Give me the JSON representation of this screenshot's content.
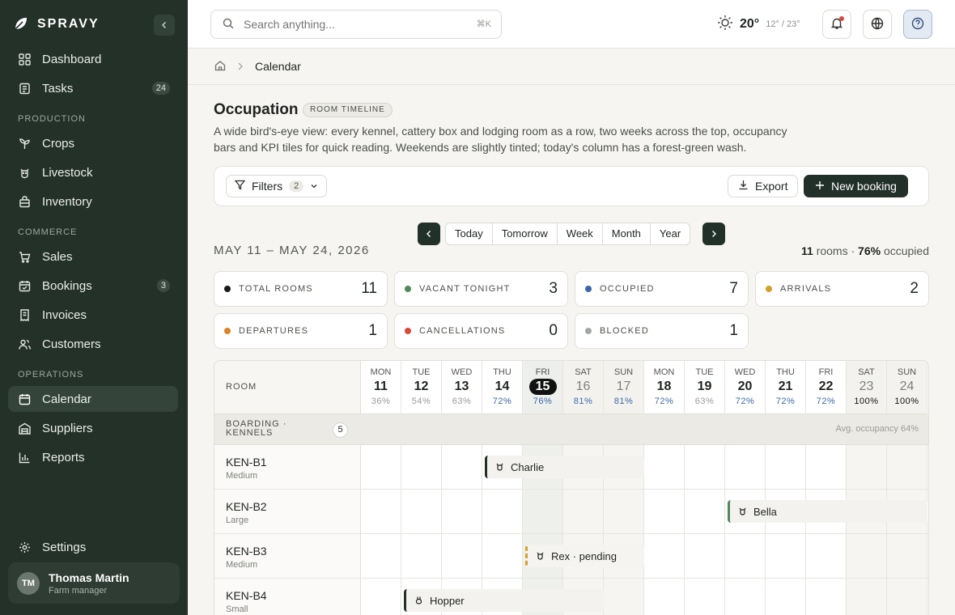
{
  "brand": {
    "name": "SPRAVY"
  },
  "sidebar": {
    "items": [
      {
        "label": "Dashboard",
        "icon": "grid-icon"
      },
      {
        "label": "Tasks",
        "icon": "clipboard-icon",
        "badge": "24"
      },
      {
        "label": "Crops",
        "icon": "sprout-icon"
      },
      {
        "label": "Livestock",
        "icon": "livestock-icon"
      },
      {
        "label": "Inventory",
        "icon": "package-icon"
      },
      {
        "label": "Sales",
        "icon": "cart-icon"
      },
      {
        "label": "Bookings",
        "icon": "calendar-check-icon",
        "badge": "3"
      },
      {
        "label": "Invoices",
        "icon": "receipt-icon"
      },
      {
        "label": "Customers",
        "icon": "users-icon"
      },
      {
        "label": "Calendar",
        "icon": "calendar-icon",
        "active": true
      },
      {
        "label": "Suppliers",
        "icon": "warehouse-icon"
      },
      {
        "label": "Reports",
        "icon": "bar-chart-icon"
      }
    ],
    "sections": {
      "production": "PRODUCTION",
      "commerce": "COMMERCE",
      "operations": "OPERATIONS"
    },
    "settings_label": "Settings",
    "user": {
      "initials": "TM",
      "name": "Thomas Martin",
      "role": "Farm manager"
    }
  },
  "topbar": {
    "search_placeholder": "Search anything...",
    "shortcut": "⌘K",
    "weather": {
      "temp": "20°",
      "range": "12° / 23°"
    }
  },
  "breadcrumb": {
    "current": "Calendar"
  },
  "page": {
    "title": "Occupation",
    "tag": "ROOM TIMELINE",
    "description": "A wide bird's-eye view: every kennel, cattery box and lodging room as a row, two weeks across the top, occupancy bars and KPI tiles for quick reading. Weekends are slightly tinted; today's column has a forest-green wash."
  },
  "toolbar": {
    "filters_label": "Filters",
    "filters_count": "2",
    "export_label": "Export",
    "new_label": "New booking"
  },
  "range_tabs": [
    "Today",
    "Tomorrow",
    "Week",
    "Month",
    "Year"
  ],
  "date_range": "MAY 11 – MAY 24, 2026",
  "summary": {
    "rooms": "11",
    "rooms_label": "rooms ·",
    "occupied": "76%",
    "occupied_label": "occupied"
  },
  "kpis": [
    {
      "label": "TOTAL ROOMS",
      "value": "11",
      "color": "#1a1a1a"
    },
    {
      "label": "VACANT TONIGHT",
      "value": "3",
      "color": "#4f8a5b"
    },
    {
      "label": "OCCUPIED",
      "value": "7",
      "color": "#3b67a8"
    },
    {
      "label": "ARRIVALS",
      "value": "2",
      "color": "#d4a02a"
    },
    {
      "label": "DEPARTURES",
      "value": "1",
      "color": "#d9822b"
    },
    {
      "label": "CANCELLATIONS",
      "value": "0",
      "color": "#d9493a"
    },
    {
      "label": "BLOCKED",
      "value": "1",
      "color": "#a3a6a1"
    }
  ],
  "grid": {
    "room_header": "ROOM",
    "days": [
      {
        "name": "MON",
        "num": "11",
        "occ": "36%"
      },
      {
        "name": "TUE",
        "num": "12",
        "occ": "54%"
      },
      {
        "name": "WED",
        "num": "13",
        "occ": "63%"
      },
      {
        "name": "THU",
        "num": "14",
        "occ": "72%"
      },
      {
        "name": "FRI",
        "num": "15",
        "occ": "76%",
        "today": true
      },
      {
        "name": "SAT",
        "num": "16",
        "occ": "81%",
        "weekend": true
      },
      {
        "name": "SUN",
        "num": "17",
        "occ": "81%",
        "weekend": true
      },
      {
        "name": "MON",
        "num": "18",
        "occ": "72%"
      },
      {
        "name": "TUE",
        "num": "19",
        "occ": "63%"
      },
      {
        "name": "WED",
        "num": "20",
        "occ": "72%"
      },
      {
        "name": "THU",
        "num": "21",
        "occ": "72%"
      },
      {
        "name": "FRI",
        "num": "22",
        "occ": "72%"
      },
      {
        "name": "SAT",
        "num": "23",
        "occ": "100%",
        "weekend": true
      },
      {
        "name": "SUN",
        "num": "24",
        "occ": "100%",
        "weekend": true
      }
    ],
    "group": {
      "label": "BOARDING · KENNELS",
      "count": "5",
      "avg": "Avg. occupancy 64%"
    },
    "rooms": [
      {
        "name": "KEN-B1",
        "size": "Medium"
      },
      {
        "name": "KEN-B2",
        "size": "Large"
      },
      {
        "name": "KEN-B3",
        "size": "Medium"
      },
      {
        "name": "KEN-B4",
        "size": "Small"
      }
    ],
    "bookings": [
      {
        "room": 0,
        "start": 3,
        "end": 7,
        "label": "Charlie",
        "icon": "dog-icon",
        "color": "#22302a",
        "style": "solid"
      },
      {
        "room": 1,
        "start": 9,
        "end": 14,
        "label": "Bella",
        "icon": "dog-icon",
        "color": "#4f8a5b",
        "style": "solid"
      },
      {
        "room": 2,
        "start": 4,
        "end": 7,
        "label": "Rex · pending",
        "icon": "dog-icon",
        "color": "#d4a02a",
        "style": "dashed"
      },
      {
        "room": 3,
        "start": 1,
        "end": 6,
        "label": "Hopper",
        "icon": "rabbit-icon",
        "color": "#22302a",
        "style": "solid"
      }
    ]
  }
}
